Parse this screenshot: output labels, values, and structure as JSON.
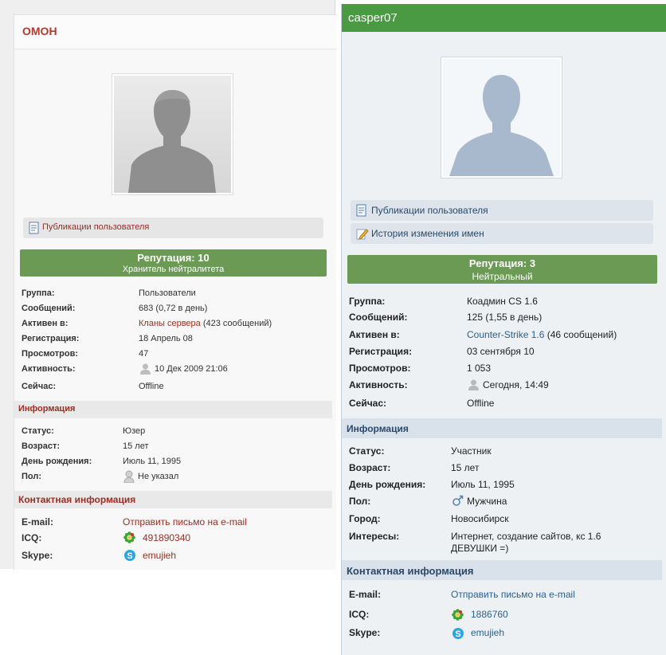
{
  "left": {
    "username": "ОМОН",
    "pub_link": "Публикации пользователя",
    "rep_title": "Репутация: 10",
    "rep_subtitle": "Хранитель нейтралитета",
    "stats": [
      {
        "label": "Группа:",
        "value": "Пользователи"
      },
      {
        "label": "Сообщений:",
        "value": "683 (0,72 в день)"
      },
      {
        "label": "Активен в:",
        "link": "Кланы сервера",
        "extra": " (423 сообщений)"
      },
      {
        "label": "Регистрация:",
        "value": "18 Апрель 08"
      },
      {
        "label": "Просмотров:",
        "value": "47"
      },
      {
        "label": "Активность:",
        "value": "10 Дек 2009 21:06"
      },
      {
        "label": "Сейчас:",
        "value": "Offline"
      }
    ],
    "info_header": "Информация",
    "info": [
      {
        "label": "Статус:",
        "value": "Юзер"
      },
      {
        "label": "Возраст:",
        "value": "15 лет"
      },
      {
        "label": "День рождения:",
        "value": "Июль 11, 1995"
      },
      {
        "label": "Пол:",
        "value": "Не указал"
      }
    ],
    "contact_header": "Контактная информация",
    "contacts": [
      {
        "label": "E-mail:",
        "value": "Отправить письмо на e-mail"
      },
      {
        "label": "ICQ:",
        "value": "491890340"
      },
      {
        "label": "Skype:",
        "value": "emujieh"
      }
    ]
  },
  "right": {
    "username": "casper07",
    "pub_link": "Публикации пользователя",
    "names_link": "История изменения имен",
    "rep_title": "Репутация: 3",
    "rep_subtitle": "Нейтральный",
    "stats": [
      {
        "label": "Группа:",
        "value": "Коадмин CS 1.6"
      },
      {
        "label": "Сообщений:",
        "value": "125 (1,55 в день)"
      },
      {
        "label": "Активен в:",
        "link": "Counter-Strike 1.6",
        "extra": " (46 сообщений)"
      },
      {
        "label": "Регистрация:",
        "value": "03 сентября 10"
      },
      {
        "label": "Просмотров:",
        "value": "1 053"
      },
      {
        "label": "Активность:",
        "value": "Сегодня, 14:49"
      },
      {
        "label": "Сейчас:",
        "value": "Offline"
      }
    ],
    "info_header": "Информация",
    "info": [
      {
        "label": "Статус:",
        "value": "Участник"
      },
      {
        "label": "Возраст:",
        "value": "15 лет"
      },
      {
        "label": "День рождения:",
        "value": "Июль 11, 1995"
      },
      {
        "label": "Пол:",
        "value": "Мужчина"
      },
      {
        "label": "Город:",
        "value": "Новосибирск"
      },
      {
        "label": "Интересы:",
        "value": "Интернет, создание сайтов, кс 1.6",
        "value2": "ДЕВУШКИ =)"
      }
    ],
    "contact_header": "Контактная информация",
    "contacts": [
      {
        "label": "E-mail:",
        "value": "Отправить письмо на e-mail"
      },
      {
        "label": "ICQ:",
        "value": "1886760"
      },
      {
        "label": "Skype:",
        "value": "emujieh"
      }
    ]
  },
  "colors": {
    "rep_green": "#6a9a54",
    "header_green": "#4a9a43",
    "left_link": "#9b2d22",
    "right_link": "#2c5f8f"
  },
  "icons": [
    "document-icon",
    "pencil-icon",
    "user-silhouette-icon",
    "male-icon",
    "icq-flower-icon",
    "skype-icon"
  ]
}
